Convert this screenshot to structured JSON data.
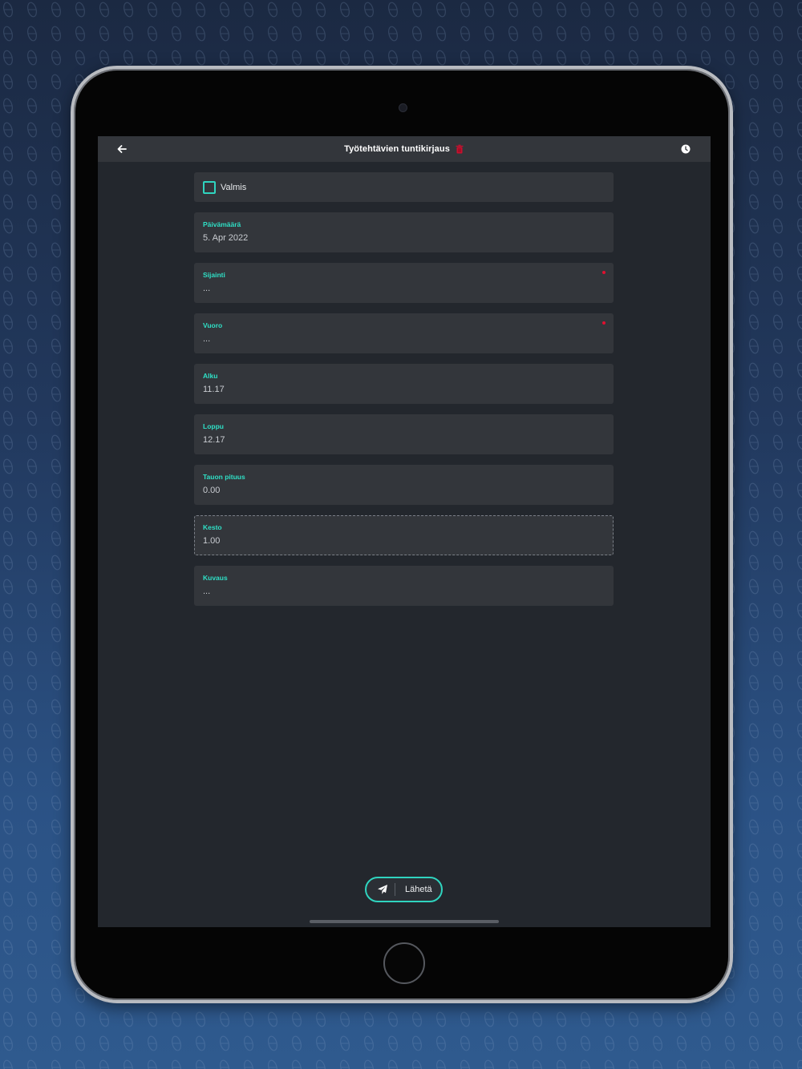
{
  "app": {
    "title": "Työtehtävien tuntikirjaus"
  },
  "topbar": {
    "back_icon": "arrow-left-icon",
    "delete_icon": "trash-icon",
    "history_icon": "clock-icon"
  },
  "form": {
    "checkbox": {
      "label": "Valmis",
      "checked": false
    },
    "fields": {
      "date": {
        "label": "Päivämäärä",
        "value": "5. Apr 2022",
        "required": false
      },
      "location": {
        "label": "Sijainti",
        "value": "...",
        "required": true
      },
      "shift": {
        "label": "Vuoro",
        "value": "...",
        "required": true
      },
      "start": {
        "label": "Alku",
        "value": "11.17",
        "required": false
      },
      "end": {
        "label": "Loppu",
        "value": "12.17",
        "required": false
      },
      "break_length": {
        "label": "Tauon pituus",
        "value": "0.00",
        "required": false
      },
      "duration": {
        "label": "Kesto",
        "value": "1.00",
        "required": false
      },
      "description": {
        "label": "Kuvaus",
        "value": "...",
        "required": false
      }
    }
  },
  "submit": {
    "label": "Lähetä",
    "icon": "paper-plane-icon"
  },
  "colors": {
    "accent": "#2fd4bf",
    "required": "#e0102f",
    "delete": "#c8102e",
    "card": "#33363b",
    "screen": "#23272d"
  }
}
